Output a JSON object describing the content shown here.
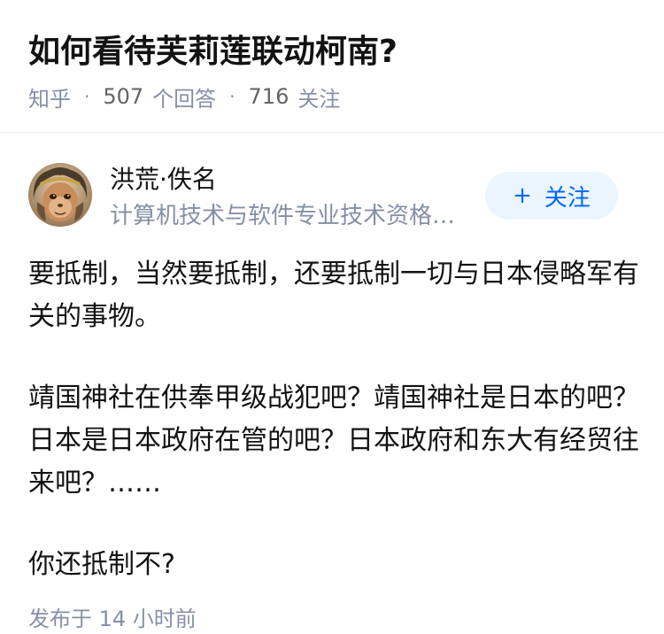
{
  "question": {
    "title": "如何看待芙莉莲联动柯南?",
    "source": "知乎",
    "separator": "·",
    "answer_count": "507",
    "answer_label": "个回答",
    "follower_count": "716",
    "follower_label": "关注"
  },
  "author": {
    "name": "洪荒·佚名",
    "bio": "计算机技术与软件专业技术资格证...",
    "avatar_icon": "monkey-king-avatar",
    "follow_label": "关注",
    "follow_icon": "plus-icon"
  },
  "answer": {
    "paragraphs": [
      "要抵制，当然要抵制，还要抵制一切与日本侵略军有关的事物。",
      "靖国神社在供奉甲级战犯吧？靖国神社是日本的吧？日本是日本政府在管的吧？日本政府和东大有经贸往来吧？……",
      "你还抵制不?"
    ],
    "publish_time": "发布于 14 小时前"
  },
  "colors": {
    "text_primary": "#121212",
    "text_secondary": "#8590a6",
    "accent_blue": "#0066ff",
    "follow_bg": "#ebf5ff",
    "divider": "#ebebeb"
  }
}
